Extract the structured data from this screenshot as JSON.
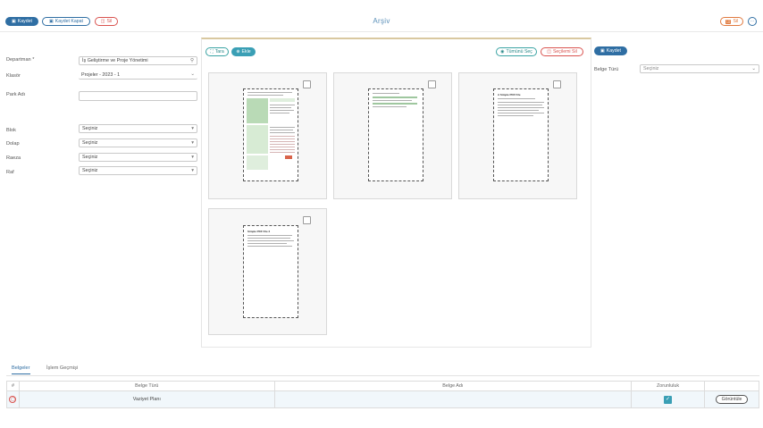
{
  "toolbar": {
    "save_label": "Kaydet",
    "save_close_label": "Kaydet Kapat",
    "delete_label": "Sil",
    "title": "Arşiv",
    "right_delete_label": "Sil"
  },
  "form": {
    "departman_label": "Departman *",
    "departman_value": "İş Geliştirme ve Proje Yönetimi",
    "klasor_label": "Klasör",
    "klasor_value": "Projeler - 2023 - 1",
    "park_adi_label": "Park Adı",
    "park_adi_value": "",
    "blok_label": "Blok",
    "blok_value": "Seçiniz",
    "dolap_label": "Dolap",
    "dolap_value": "Seçiniz",
    "raeza_label": "Raeza",
    "raeza_value": "Seçiniz",
    "raf_label": "Raf",
    "raf_value": "Seçiniz"
  },
  "viewer": {
    "tara_label": "Tara",
    "ekle_label": "Ekle",
    "select_all_label": "Tümünü Seç",
    "delete_selected_label": "Seçilemi Sil",
    "doc3_title": "A Simple PDF File",
    "doc4_title": "Simple PDF File 2"
  },
  "right": {
    "save_label": "Kaydet",
    "belge_turu_label": "Belge Türü",
    "belge_turu_value": "Seçiniz"
  },
  "tabs": {
    "belgeler": "Belgeler",
    "islem_gecmisi": "İşlem Geçmişi"
  },
  "table": {
    "headers": [
      "#",
      "Belge Türü",
      "Belge Adı",
      "Zorunluluk",
      ""
    ],
    "rows": [
      {
        "belge_turu": "Vaziyet Planı",
        "belge_adi": "",
        "action": "Görüntüle"
      }
    ]
  },
  "colors": {
    "primary": "#2f6ea3",
    "teal": "#3a9fb5",
    "danger": "#d9534f",
    "orange": "#e07a3f"
  }
}
